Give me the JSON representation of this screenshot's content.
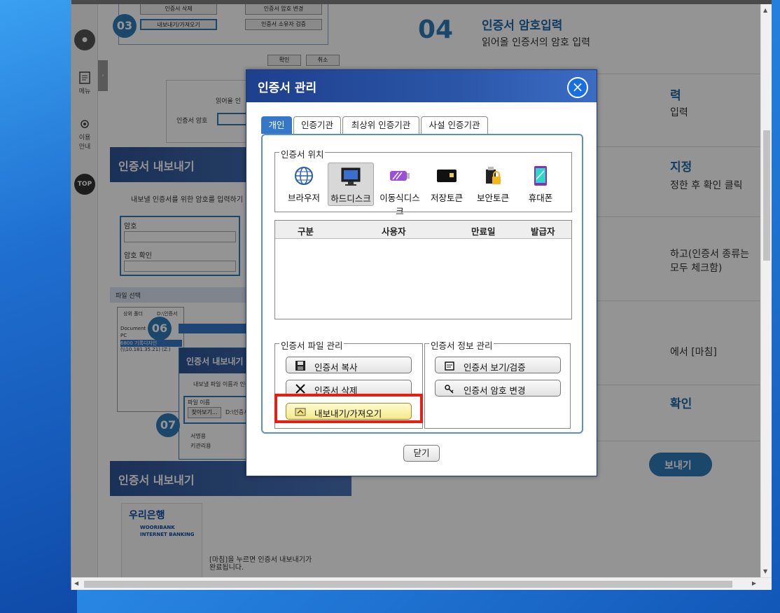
{
  "rail": {
    "menu_label": "메뉴",
    "guide_label": "이용\n안내",
    "top_label": "TOP"
  },
  "background": {
    "top_buttons": [
      "인증서 삭제",
      "인증서 암호 변경",
      "내보내기/가져오기",
      "인증서 소유자 검증"
    ],
    "ok": "확인",
    "cancel": "취소",
    "read_label": "읽어올 인",
    "pw_label": "인증서 암호",
    "section1_title": "인증서 내보내기",
    "section1_desc": "내보낼 인증서를 위한 암호를 입력하기",
    "pw": "암호",
    "pw_confirm": "암호 확인",
    "file_select": "파일 선택",
    "sub_title": "인증서 내보내기",
    "sub_desc": "내보낼 파일 이름과 인증",
    "file_name": "파일 이름",
    "browse": "찾아보기...",
    "path": "D:\\인증서",
    "tree": [
      "Document",
      "PC",
      "6800 기록디자인",
      "(\\\\10.181.35.21) (Z:)"
    ],
    "tree_top": "상위 폴더",
    "tree_path": "D:\\인증서",
    "cb1": "서명용",
    "cb2": "키관리용",
    "section2_title": "인증서 내보내기",
    "bank_name": "우리은행",
    "bank_en1": "WOORIBANK",
    "bank_en2": "INTERNET BANKING",
    "bank_desc": "[마침]을 누르면 인증서 내보내기가\n완료됩니다.",
    "num03": "03",
    "num06": "06",
    "num07": "07",
    "step04_num": "04",
    "step04_title": "인증서 암호입력",
    "step04_desc": "읽어올 인증서의 암호 입력",
    "step05_title": "력",
    "step05_desc": "입력",
    "step06_title": "지정",
    "step06_desc": "정한 후 확인 클릭",
    "step07_desc": "하고(인증서 종류는 모두 체크함)",
    "step08_desc": "에서 [마침]",
    "step09_title": "확인",
    "step10_btn": "보내기"
  },
  "dialog": {
    "title": "인증서 관리",
    "tabs": [
      "개인",
      "인증기관",
      "최상위 인증기관",
      "사설 인증기관"
    ],
    "location_legend": "인증서 위치",
    "locations": [
      "브라우저",
      "하드디스크",
      "이동식디스크",
      "저장토큰",
      "보안토큰",
      "휴대폰"
    ],
    "columns": [
      "구분",
      "사용자",
      "만료일",
      "발급자"
    ],
    "file_mgmt_legend": "인증서 파일 관리",
    "info_mgmt_legend": "인증서 정보 관리",
    "btn_copy": "인증서 복사",
    "btn_delete": "인증서 삭제",
    "btn_export": "내보내기/가져오기",
    "btn_view": "인증서 보기/검증",
    "btn_pw": "인증서 암호 변경",
    "btn_close": "닫기"
  },
  "colors": {
    "accent": "#3577c8",
    "title_bar": "#1e3f8c",
    "highlight": "#e81e12"
  }
}
